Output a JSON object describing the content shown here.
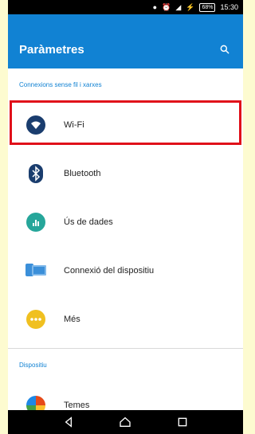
{
  "status_bar": {
    "time": "15:30",
    "battery": "68%"
  },
  "appbar": {
    "title": "Paràmetres",
    "search_icon": "search-icon"
  },
  "sections": [
    {
      "header": "Connexions sense fil i xarxes",
      "items": [
        {
          "label": "Wi-Fi",
          "icon": "wifi-icon",
          "color": "#1a3d6e",
          "highlighted": true
        },
        {
          "label": "Bluetooth",
          "icon": "bluetooth-icon",
          "color": "#1a3d6e"
        },
        {
          "label": "Ús de dades",
          "icon": "data-usage-icon",
          "color": "#26a69a"
        },
        {
          "label": "Connexió del dispositiu",
          "icon": "device-connection-icon",
          "color": "#3b8fd9"
        },
        {
          "label": "Més",
          "icon": "more-icon",
          "color": "#f0c020"
        }
      ]
    },
    {
      "header": "Dispositiu",
      "items": [
        {
          "label": "Temes",
          "icon": "themes-icon",
          "color": "#e64a19"
        }
      ]
    }
  ],
  "navbar": {
    "back": "back-icon",
    "home": "home-icon",
    "recents": "recents-icon"
  },
  "colors": {
    "accent": "#1182d3",
    "highlight": "#e0101a",
    "background": "#fdfbd0"
  }
}
